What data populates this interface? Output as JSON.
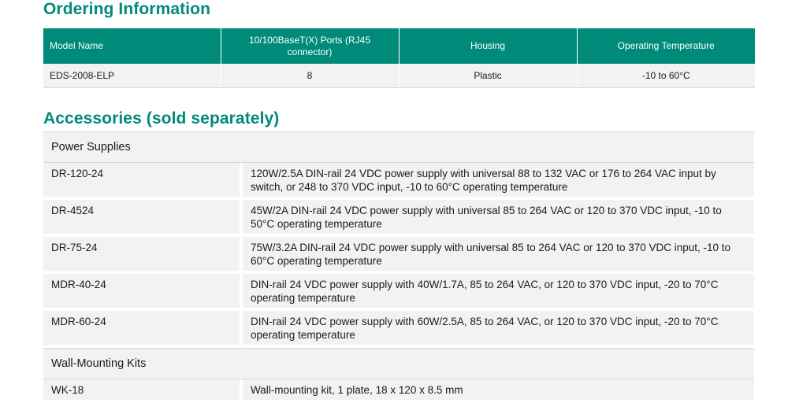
{
  "ordering": {
    "title": "Ordering Information",
    "headers": [
      "Model Name",
      "10/100BaseT(X) Ports (RJ45 connector)",
      "Housing",
      "Operating Temperature"
    ],
    "rows": [
      [
        "EDS-2008-ELP",
        "8",
        "Plastic",
        "-10 to 60°C"
      ]
    ]
  },
  "accessories": {
    "title": "Accessories (sold separately)",
    "groups": [
      {
        "name": "Power Supplies",
        "items": [
          {
            "model": "DR-120-24",
            "desc": "120W/2.5A DIN-rail 24 VDC power supply with universal 88 to 132 VAC or 176 to 264 VAC input by switch, or 248 to 370 VDC input, -10 to 60°C operating temperature"
          },
          {
            "model": "DR-4524",
            "desc": "45W/2A DIN-rail 24 VDC power supply with universal 85 to 264 VAC or 120 to 370 VDC input, -10 to 50°C operating temperature"
          },
          {
            "model": "DR-75-24",
            "desc": "75W/3.2A DIN-rail 24 VDC power supply with universal 85 to 264 VAC or 120 to 370 VDC input, -10 to 60°C operating temperature"
          },
          {
            "model": "MDR-40-24",
            "desc": "DIN-rail 24 VDC power supply with 40W/1.7A, 85 to 264 VAC, or 120 to 370 VDC input, -20 to 70°C operating temperature"
          },
          {
            "model": "MDR-60-24",
            "desc": "DIN-rail 24 VDC power supply with 60W/2.5A, 85 to 264 VAC, or 120 to 370 VDC input, -20 to 70°C operating temperature"
          }
        ]
      },
      {
        "name": "Wall-Mounting Kits",
        "items": [
          {
            "model": "WK-18",
            "desc": "Wall-mounting kit, 1 plate, 18 x 120 x 8.5 mm"
          }
        ]
      }
    ]
  },
  "colors": {
    "accent": "#008a7a",
    "row_bg": "#f2f2f2"
  }
}
